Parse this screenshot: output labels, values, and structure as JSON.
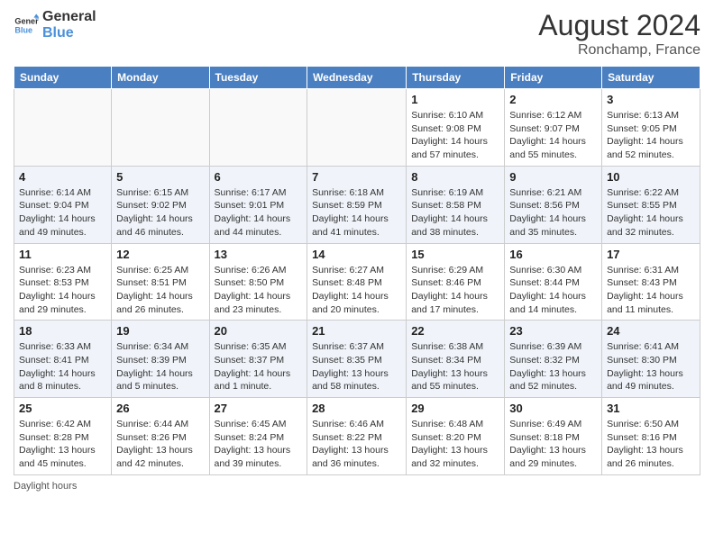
{
  "header": {
    "logo_line1": "General",
    "logo_line2": "Blue",
    "month_year": "August 2024",
    "location": "Ronchamp, France"
  },
  "footer": {
    "note": "Daylight hours"
  },
  "weekdays": [
    "Sunday",
    "Monday",
    "Tuesday",
    "Wednesday",
    "Thursday",
    "Friday",
    "Saturday"
  ],
  "weeks": [
    [
      {
        "day": "",
        "sunrise": "",
        "sunset": "",
        "daylight": ""
      },
      {
        "day": "",
        "sunrise": "",
        "sunset": "",
        "daylight": ""
      },
      {
        "day": "",
        "sunrise": "",
        "sunset": "",
        "daylight": ""
      },
      {
        "day": "",
        "sunrise": "",
        "sunset": "",
        "daylight": ""
      },
      {
        "day": "1",
        "sunrise": "6:10 AM",
        "sunset": "9:08 PM",
        "daylight": "14 hours and 57 minutes."
      },
      {
        "day": "2",
        "sunrise": "6:12 AM",
        "sunset": "9:07 PM",
        "daylight": "14 hours and 55 minutes."
      },
      {
        "day": "3",
        "sunrise": "6:13 AM",
        "sunset": "9:05 PM",
        "daylight": "14 hours and 52 minutes."
      }
    ],
    [
      {
        "day": "4",
        "sunrise": "6:14 AM",
        "sunset": "9:04 PM",
        "daylight": "14 hours and 49 minutes."
      },
      {
        "day": "5",
        "sunrise": "6:15 AM",
        "sunset": "9:02 PM",
        "daylight": "14 hours and 46 minutes."
      },
      {
        "day": "6",
        "sunrise": "6:17 AM",
        "sunset": "9:01 PM",
        "daylight": "14 hours and 44 minutes."
      },
      {
        "day": "7",
        "sunrise": "6:18 AM",
        "sunset": "8:59 PM",
        "daylight": "14 hours and 41 minutes."
      },
      {
        "day": "8",
        "sunrise": "6:19 AM",
        "sunset": "8:58 PM",
        "daylight": "14 hours and 38 minutes."
      },
      {
        "day": "9",
        "sunrise": "6:21 AM",
        "sunset": "8:56 PM",
        "daylight": "14 hours and 35 minutes."
      },
      {
        "day": "10",
        "sunrise": "6:22 AM",
        "sunset": "8:55 PM",
        "daylight": "14 hours and 32 minutes."
      }
    ],
    [
      {
        "day": "11",
        "sunrise": "6:23 AM",
        "sunset": "8:53 PM",
        "daylight": "14 hours and 29 minutes."
      },
      {
        "day": "12",
        "sunrise": "6:25 AM",
        "sunset": "8:51 PM",
        "daylight": "14 hours and 26 minutes."
      },
      {
        "day": "13",
        "sunrise": "6:26 AM",
        "sunset": "8:50 PM",
        "daylight": "14 hours and 23 minutes."
      },
      {
        "day": "14",
        "sunrise": "6:27 AM",
        "sunset": "8:48 PM",
        "daylight": "14 hours and 20 minutes."
      },
      {
        "day": "15",
        "sunrise": "6:29 AM",
        "sunset": "8:46 PM",
        "daylight": "14 hours and 17 minutes."
      },
      {
        "day": "16",
        "sunrise": "6:30 AM",
        "sunset": "8:44 PM",
        "daylight": "14 hours and 14 minutes."
      },
      {
        "day": "17",
        "sunrise": "6:31 AM",
        "sunset": "8:43 PM",
        "daylight": "14 hours and 11 minutes."
      }
    ],
    [
      {
        "day": "18",
        "sunrise": "6:33 AM",
        "sunset": "8:41 PM",
        "daylight": "14 hours and 8 minutes."
      },
      {
        "day": "19",
        "sunrise": "6:34 AM",
        "sunset": "8:39 PM",
        "daylight": "14 hours and 5 minutes."
      },
      {
        "day": "20",
        "sunrise": "6:35 AM",
        "sunset": "8:37 PM",
        "daylight": "14 hours and 1 minute."
      },
      {
        "day": "21",
        "sunrise": "6:37 AM",
        "sunset": "8:35 PM",
        "daylight": "13 hours and 58 minutes."
      },
      {
        "day": "22",
        "sunrise": "6:38 AM",
        "sunset": "8:34 PM",
        "daylight": "13 hours and 55 minutes."
      },
      {
        "day": "23",
        "sunrise": "6:39 AM",
        "sunset": "8:32 PM",
        "daylight": "13 hours and 52 minutes."
      },
      {
        "day": "24",
        "sunrise": "6:41 AM",
        "sunset": "8:30 PM",
        "daylight": "13 hours and 49 minutes."
      }
    ],
    [
      {
        "day": "25",
        "sunrise": "6:42 AM",
        "sunset": "8:28 PM",
        "daylight": "13 hours and 45 minutes."
      },
      {
        "day": "26",
        "sunrise": "6:44 AM",
        "sunset": "8:26 PM",
        "daylight": "13 hours and 42 minutes."
      },
      {
        "day": "27",
        "sunrise": "6:45 AM",
        "sunset": "8:24 PM",
        "daylight": "13 hours and 39 minutes."
      },
      {
        "day": "28",
        "sunrise": "6:46 AM",
        "sunset": "8:22 PM",
        "daylight": "13 hours and 36 minutes."
      },
      {
        "day": "29",
        "sunrise": "6:48 AM",
        "sunset": "8:20 PM",
        "daylight": "13 hours and 32 minutes."
      },
      {
        "day": "30",
        "sunrise": "6:49 AM",
        "sunset": "8:18 PM",
        "daylight": "13 hours and 29 minutes."
      },
      {
        "day": "31",
        "sunrise": "6:50 AM",
        "sunset": "8:16 PM",
        "daylight": "13 hours and 26 minutes."
      }
    ]
  ]
}
